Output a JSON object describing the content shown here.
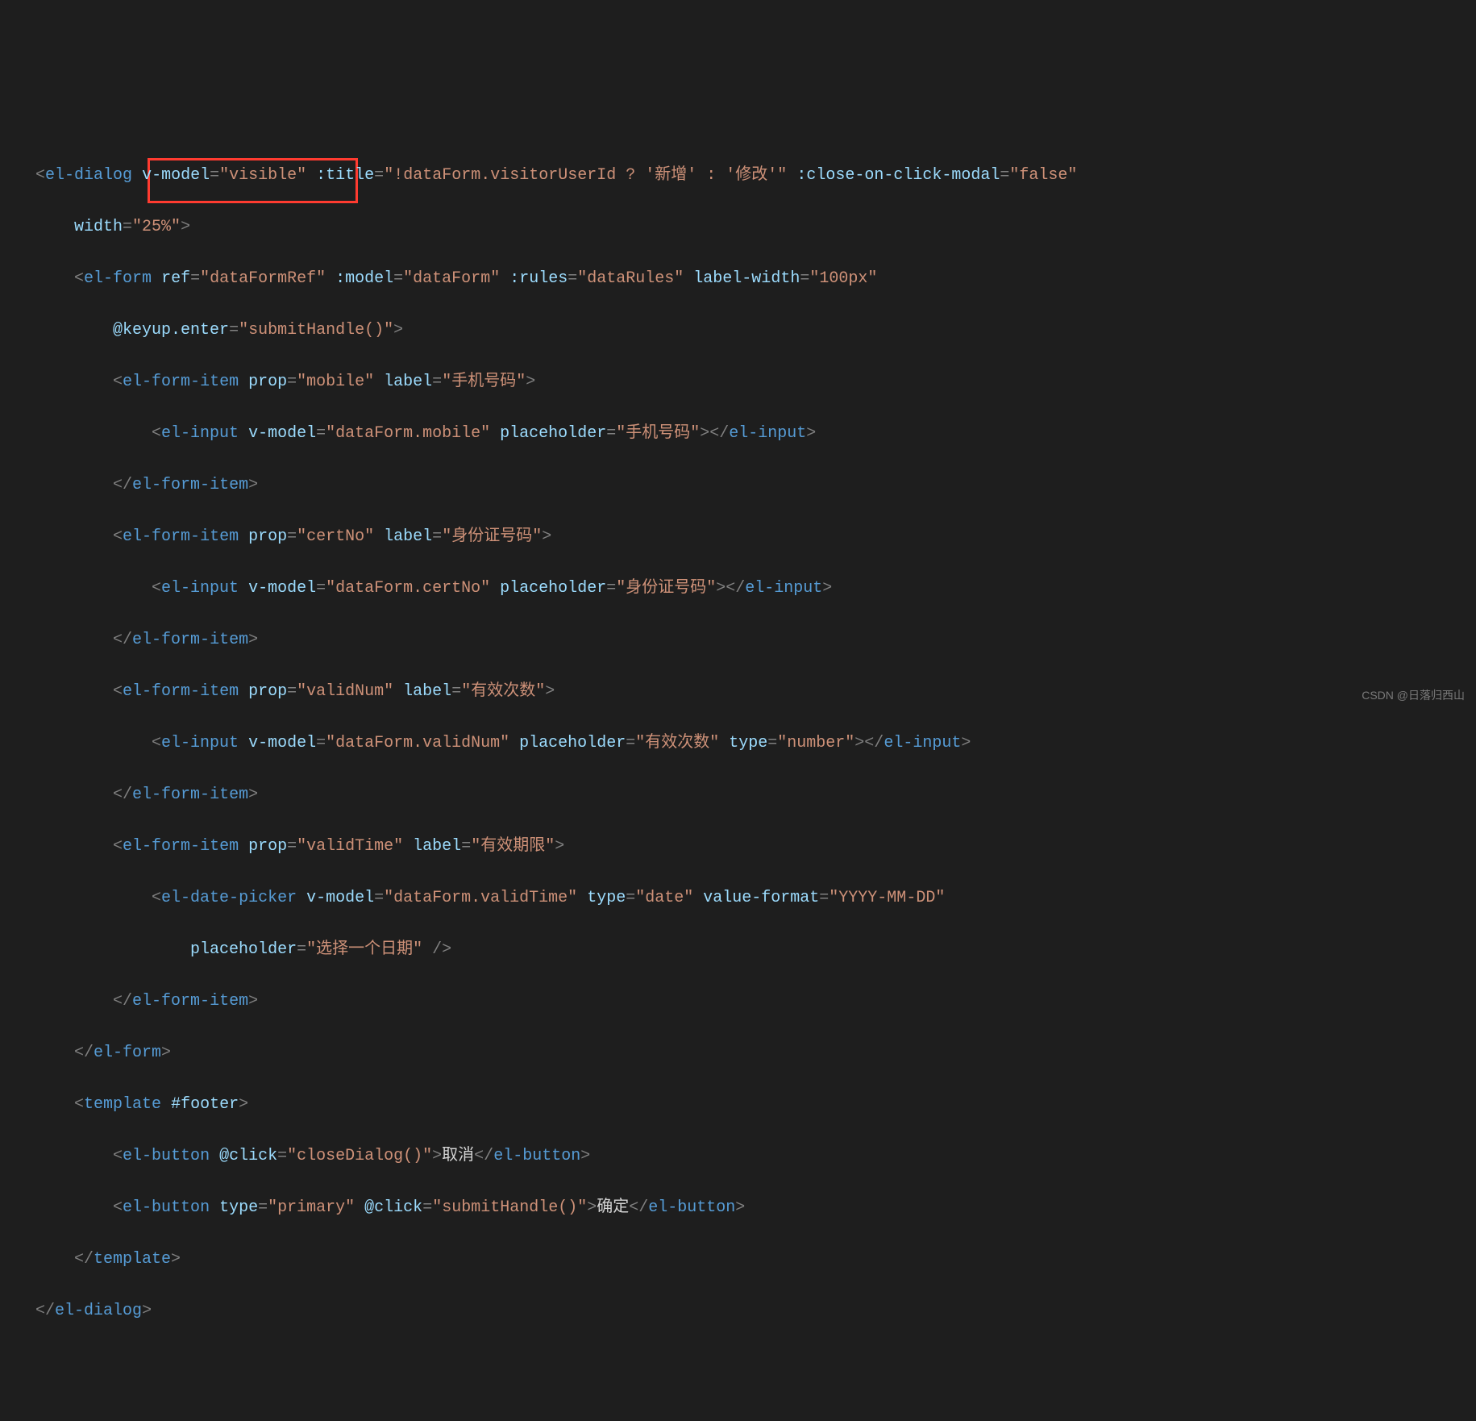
{
  "code": {
    "dialog_open": "<el-dialog",
    "dialog_vmodel_attr": "v-model",
    "dialog_vmodel_val": "\"visible\"",
    "dialog_title_attr": ":title",
    "dialog_title_val1": "\"!dataForm.visitorUserId ? ",
    "dialog_title_str1": "'新增'",
    "dialog_title_mid": " : ",
    "dialog_title_str2": "'修改'",
    "dialog_title_end": "\"",
    "dialog_close_attr": ":close-on-click-modal",
    "dialog_close_val": "\"false\"",
    "dialog_width_attr": "width",
    "dialog_width_val": "\"25%\"",
    "form_open": "<el-form",
    "form_ref_attr": "ref",
    "form_ref_val": "\"dataFormRef\"",
    "form_model_attr": ":model",
    "form_model_val": "\"dataForm\"",
    "form_rules_attr": ":rules",
    "form_rules_val": "\"dataRules\"",
    "form_labelw_attr": "label-width",
    "form_labelw_val": "\"100px\"",
    "form_keyup_attr": "@keyup.enter",
    "form_keyup_val": "\"submitHandle()\"",
    "item_open": "<el-form-item",
    "item_close": "</el-form-item>",
    "prop_attr": "prop",
    "label_attr": "label",
    "mobile_prop": "\"mobile\"",
    "mobile_label": "\"手机号码\"",
    "certno_prop": "\"certNo\"",
    "certno_label": "\"身份证号码\"",
    "validnum_prop": "\"validNum\"",
    "validnum_label": "\"有效次数\"",
    "validtime_prop": "\"validTime\"",
    "validtime_label": "\"有效期限\"",
    "input_open": "<el-input",
    "input_close": "</el-input>",
    "vmodel_attr": "v-model",
    "placeholder_attr": "placeholder",
    "type_attr": "type",
    "mobile_model": "\"dataForm.mobile\"",
    "mobile_ph": "\"手机号码\"",
    "certno_model": "\"dataForm.certNo\"",
    "certno_ph": "\"身份证号码\"",
    "validnum_model": "\"dataForm.validNum\"",
    "validnum_ph": "\"有效次数\"",
    "validnum_type": "\"number\"",
    "dp_open": "<el-date-picker",
    "dp_model": "\"dataForm.validTime\"",
    "dp_type": "\"date\"",
    "dp_vf_attr": "value-format",
    "dp_vf_val": "\"YYYY-MM-DD\"",
    "dp_ph": "\"选择一个日期\"",
    "form_close": "</el-form>",
    "tmpl_open": "<template",
    "tmpl_footer": "#footer",
    "tmpl_close": "</template>",
    "btn_open": "<el-button",
    "btn_close": "</el-button>",
    "click_attr": "@click",
    "close_click": "\"closeDialog()\"",
    "cancel_text": "取消",
    "primary_attr": "type",
    "primary_val": "\"primary\"",
    "submit_click": "\"submitHandle()\"",
    "ok_text": "确定",
    "dialog_close": "</el-dialog>"
  },
  "watermark": "CSDN @日落归西山"
}
